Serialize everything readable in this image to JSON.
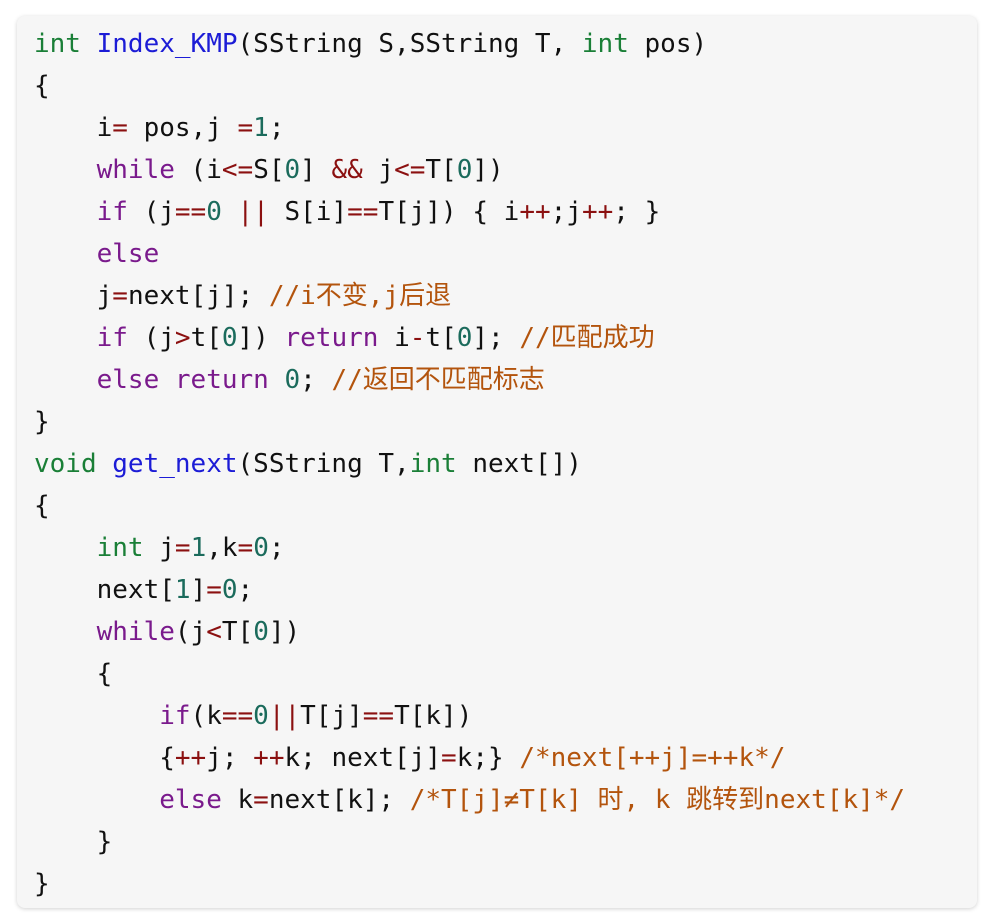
{
  "colors": {
    "panel_background": "#f6f6f6",
    "plain": "#111111",
    "type": "#1a7f37",
    "function": "#1c1cd6",
    "keyword": "#7a1a8c",
    "operator": "#8b1010",
    "number": "#1b6b5c",
    "comment": "#b3540d"
  },
  "code": {
    "lines": [
      {
        "indent": 0,
        "tokens": [
          {
            "t": "int",
            "c": "type"
          },
          {
            "t": " ",
            "c": "plain"
          },
          {
            "t": "Index_KMP",
            "c": "func"
          },
          {
            "t": "(SString S,SString T, ",
            "c": "plain"
          },
          {
            "t": "int",
            "c": "type"
          },
          {
            "t": " pos)",
            "c": "plain"
          }
        ]
      },
      {
        "indent": 0,
        "tokens": [
          {
            "t": "{",
            "c": "plain"
          }
        ]
      },
      {
        "indent": 1,
        "tokens": [
          {
            "t": "i",
            "c": "plain"
          },
          {
            "t": "=",
            "c": "op"
          },
          {
            "t": " pos,j ",
            "c": "plain"
          },
          {
            "t": "=",
            "c": "op"
          },
          {
            "t": "1",
            "c": "num"
          },
          {
            "t": ";",
            "c": "plain"
          }
        ]
      },
      {
        "indent": 1,
        "tokens": [
          {
            "t": "while",
            "c": "kw"
          },
          {
            "t": " (i",
            "c": "plain"
          },
          {
            "t": "<=",
            "c": "op"
          },
          {
            "t": "S[",
            "c": "plain"
          },
          {
            "t": "0",
            "c": "num"
          },
          {
            "t": "] ",
            "c": "plain"
          },
          {
            "t": "&&",
            "c": "op"
          },
          {
            "t": " j",
            "c": "plain"
          },
          {
            "t": "<=",
            "c": "op"
          },
          {
            "t": "T[",
            "c": "plain"
          },
          {
            "t": "0",
            "c": "num"
          },
          {
            "t": "])",
            "c": "plain"
          }
        ]
      },
      {
        "indent": 1,
        "tokens": [
          {
            "t": "if",
            "c": "kw"
          },
          {
            "t": " (j",
            "c": "plain"
          },
          {
            "t": "==",
            "c": "op"
          },
          {
            "t": "0",
            "c": "num"
          },
          {
            "t": " ",
            "c": "plain"
          },
          {
            "t": "||",
            "c": "op"
          },
          {
            "t": " S[i]",
            "c": "plain"
          },
          {
            "t": "==",
            "c": "op"
          },
          {
            "t": "T[j]) { i",
            "c": "plain"
          },
          {
            "t": "++",
            "c": "op"
          },
          {
            "t": ";j",
            "c": "plain"
          },
          {
            "t": "++",
            "c": "op"
          },
          {
            "t": "; }",
            "c": "plain"
          }
        ]
      },
      {
        "indent": 1,
        "tokens": [
          {
            "t": "else",
            "c": "kw"
          }
        ]
      },
      {
        "indent": 1,
        "tokens": [
          {
            "t": "j",
            "c": "plain"
          },
          {
            "t": "=",
            "c": "op"
          },
          {
            "t": "next[j]; ",
            "c": "plain"
          },
          {
            "t": "//i不变,j后退",
            "c": "comment"
          }
        ]
      },
      {
        "indent": 1,
        "tokens": [
          {
            "t": "if",
            "c": "kw"
          },
          {
            "t": " (j",
            "c": "plain"
          },
          {
            "t": ">",
            "c": "op"
          },
          {
            "t": "t[",
            "c": "plain"
          },
          {
            "t": "0",
            "c": "num"
          },
          {
            "t": "]) ",
            "c": "plain"
          },
          {
            "t": "return",
            "c": "kw"
          },
          {
            "t": " i",
            "c": "plain"
          },
          {
            "t": "-",
            "c": "op"
          },
          {
            "t": "t[",
            "c": "plain"
          },
          {
            "t": "0",
            "c": "num"
          },
          {
            "t": "]; ",
            "c": "plain"
          },
          {
            "t": "//匹配成功",
            "c": "comment"
          }
        ]
      },
      {
        "indent": 1,
        "tokens": [
          {
            "t": "else",
            "c": "kw"
          },
          {
            "t": " ",
            "c": "plain"
          },
          {
            "t": "return",
            "c": "kw"
          },
          {
            "t": " ",
            "c": "plain"
          },
          {
            "t": "0",
            "c": "num"
          },
          {
            "t": "; ",
            "c": "plain"
          },
          {
            "t": "//返回不匹配标志",
            "c": "comment"
          }
        ]
      },
      {
        "indent": 0,
        "tokens": [
          {
            "t": "}",
            "c": "plain"
          }
        ]
      },
      {
        "indent": 0,
        "tokens": [
          {
            "t": "void",
            "c": "type"
          },
          {
            "t": " ",
            "c": "plain"
          },
          {
            "t": "get_next",
            "c": "func"
          },
          {
            "t": "(SString T,",
            "c": "plain"
          },
          {
            "t": "int",
            "c": "type"
          },
          {
            "t": " next[])",
            "c": "plain"
          }
        ]
      },
      {
        "indent": 0,
        "tokens": [
          {
            "t": "{",
            "c": "plain"
          }
        ]
      },
      {
        "indent": 1,
        "tokens": [
          {
            "t": "int",
            "c": "type"
          },
          {
            "t": " j",
            "c": "plain"
          },
          {
            "t": "=",
            "c": "op"
          },
          {
            "t": "1",
            "c": "num"
          },
          {
            "t": ",k",
            "c": "plain"
          },
          {
            "t": "=",
            "c": "op"
          },
          {
            "t": "0",
            "c": "num"
          },
          {
            "t": ";",
            "c": "plain"
          }
        ]
      },
      {
        "indent": 1,
        "tokens": [
          {
            "t": "next[",
            "c": "plain"
          },
          {
            "t": "1",
            "c": "num"
          },
          {
            "t": "]",
            "c": "plain"
          },
          {
            "t": "=",
            "c": "op"
          },
          {
            "t": "0",
            "c": "num"
          },
          {
            "t": ";",
            "c": "plain"
          }
        ]
      },
      {
        "indent": 1,
        "tokens": [
          {
            "t": "while",
            "c": "kw"
          },
          {
            "t": "(j",
            "c": "plain"
          },
          {
            "t": "<",
            "c": "op"
          },
          {
            "t": "T[",
            "c": "plain"
          },
          {
            "t": "0",
            "c": "num"
          },
          {
            "t": "])",
            "c": "plain"
          }
        ]
      },
      {
        "indent": 1,
        "tokens": [
          {
            "t": "{",
            "c": "plain"
          }
        ]
      },
      {
        "indent": 2,
        "tokens": [
          {
            "t": "if",
            "c": "kw"
          },
          {
            "t": "(k",
            "c": "plain"
          },
          {
            "t": "==",
            "c": "op"
          },
          {
            "t": "0",
            "c": "num"
          },
          {
            "t": "||",
            "c": "op"
          },
          {
            "t": "T[j]",
            "c": "plain"
          },
          {
            "t": "==",
            "c": "op"
          },
          {
            "t": "T[k])",
            "c": "plain"
          }
        ]
      },
      {
        "indent": 2,
        "tokens": [
          {
            "t": "{",
            "c": "plain"
          },
          {
            "t": "++",
            "c": "op"
          },
          {
            "t": "j; ",
            "c": "plain"
          },
          {
            "t": "++",
            "c": "op"
          },
          {
            "t": "k; next[j]",
            "c": "plain"
          },
          {
            "t": "=",
            "c": "op"
          },
          {
            "t": "k;} ",
            "c": "plain"
          },
          {
            "t": "/*next[++j]=++k*/",
            "c": "comment"
          }
        ]
      },
      {
        "indent": 2,
        "tokens": [
          {
            "t": "else",
            "c": "kw"
          },
          {
            "t": " k",
            "c": "plain"
          },
          {
            "t": "=",
            "c": "op"
          },
          {
            "t": "next[k]; ",
            "c": "plain"
          },
          {
            "t": "/*T[j]≠T[k] 时, k 跳转到next[k]*/",
            "c": "comment"
          }
        ]
      },
      {
        "indent": 1,
        "tokens": [
          {
            "t": "}",
            "c": "plain"
          }
        ]
      },
      {
        "indent": 0,
        "tokens": [
          {
            "t": "}",
            "c": "plain"
          }
        ]
      }
    ]
  }
}
